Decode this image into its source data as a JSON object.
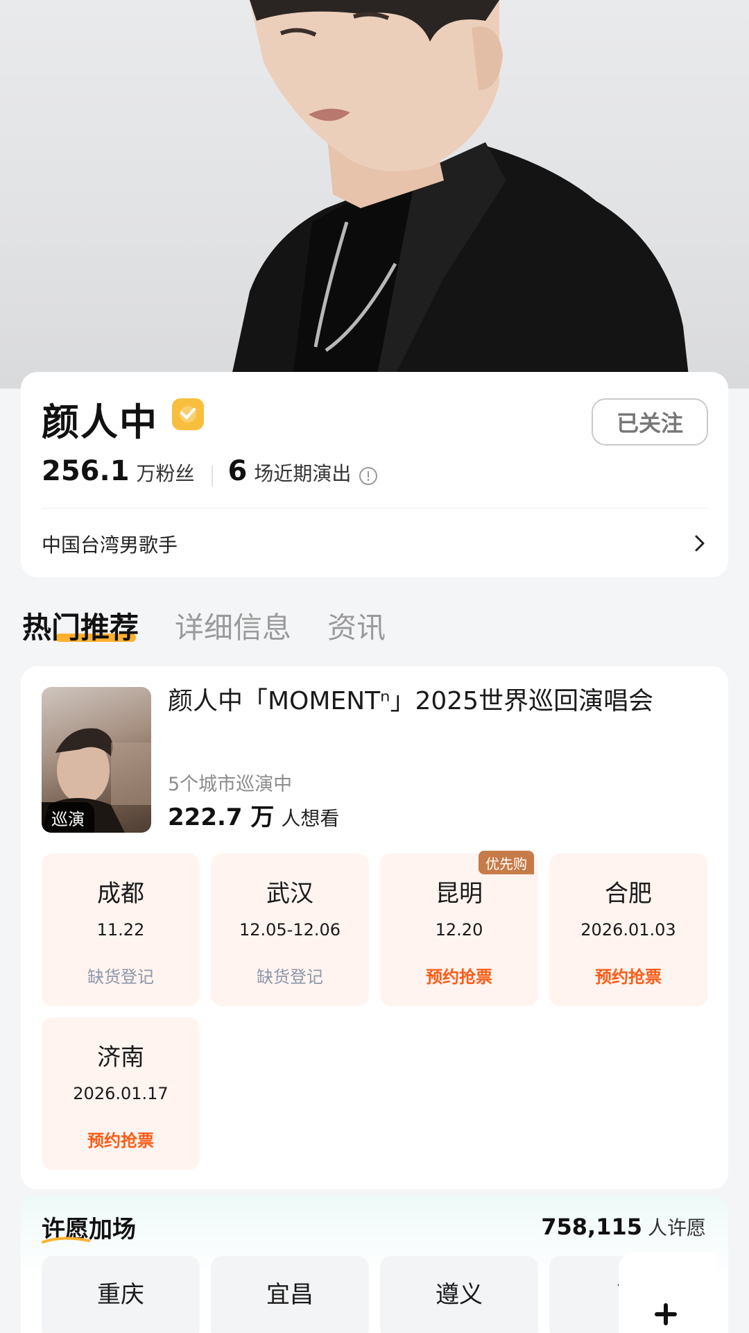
{
  "artist": {
    "name": "颜人中",
    "follow_label": "已关注",
    "fans_count": "256.1",
    "fans_label": "万粉丝",
    "shows_count": "6",
    "shows_label": "场近期演出",
    "description": "中国台湾男歌手"
  },
  "tabs": [
    {
      "label": "热门推荐",
      "active": true
    },
    {
      "label": "详细信息",
      "active": false
    },
    {
      "label": "资讯",
      "active": false
    }
  ],
  "concert": {
    "poster_badge": "巡演",
    "title": "颜人中「MOMENTⁿ」2025世界巡回演唱会",
    "cities_summary": "5个城市巡演中",
    "want_count": "222.7 万",
    "want_label": "人想看",
    "cities": [
      {
        "name": "成都",
        "date": "11.22",
        "status": "缺货登记",
        "status_type": "soldout",
        "badge": ""
      },
      {
        "name": "武汉",
        "date": "12.05-12.06",
        "status": "缺货登记",
        "status_type": "soldout",
        "badge": ""
      },
      {
        "name": "昆明",
        "date": "12.20",
        "status": "预约抢票",
        "status_type": "book",
        "badge": "优先购"
      },
      {
        "name": "合肥",
        "date": "2026.01.03",
        "status": "预约抢票",
        "status_type": "book",
        "badge": ""
      },
      {
        "name": "济南",
        "date": "2026.01.17",
        "status": "预约抢票",
        "status_type": "book",
        "badge": ""
      }
    ]
  },
  "wish": {
    "title": "许愿加场",
    "count": "758,115",
    "count_label": "人许愿",
    "cities": [
      "重庆",
      "宜昌",
      "遵义",
      "西"
    ]
  },
  "colors": {
    "accent_orange": "#ff5a14",
    "verified_yellow": "#f8bf3e",
    "soldout_grey": "#8e96aa",
    "tile_bg": "#fff4f0"
  },
  "icons": {
    "verified": "verified-check-icon",
    "info": "info-circle-icon",
    "chevron": "chevron-right-icon",
    "plus": "plus-icon"
  }
}
